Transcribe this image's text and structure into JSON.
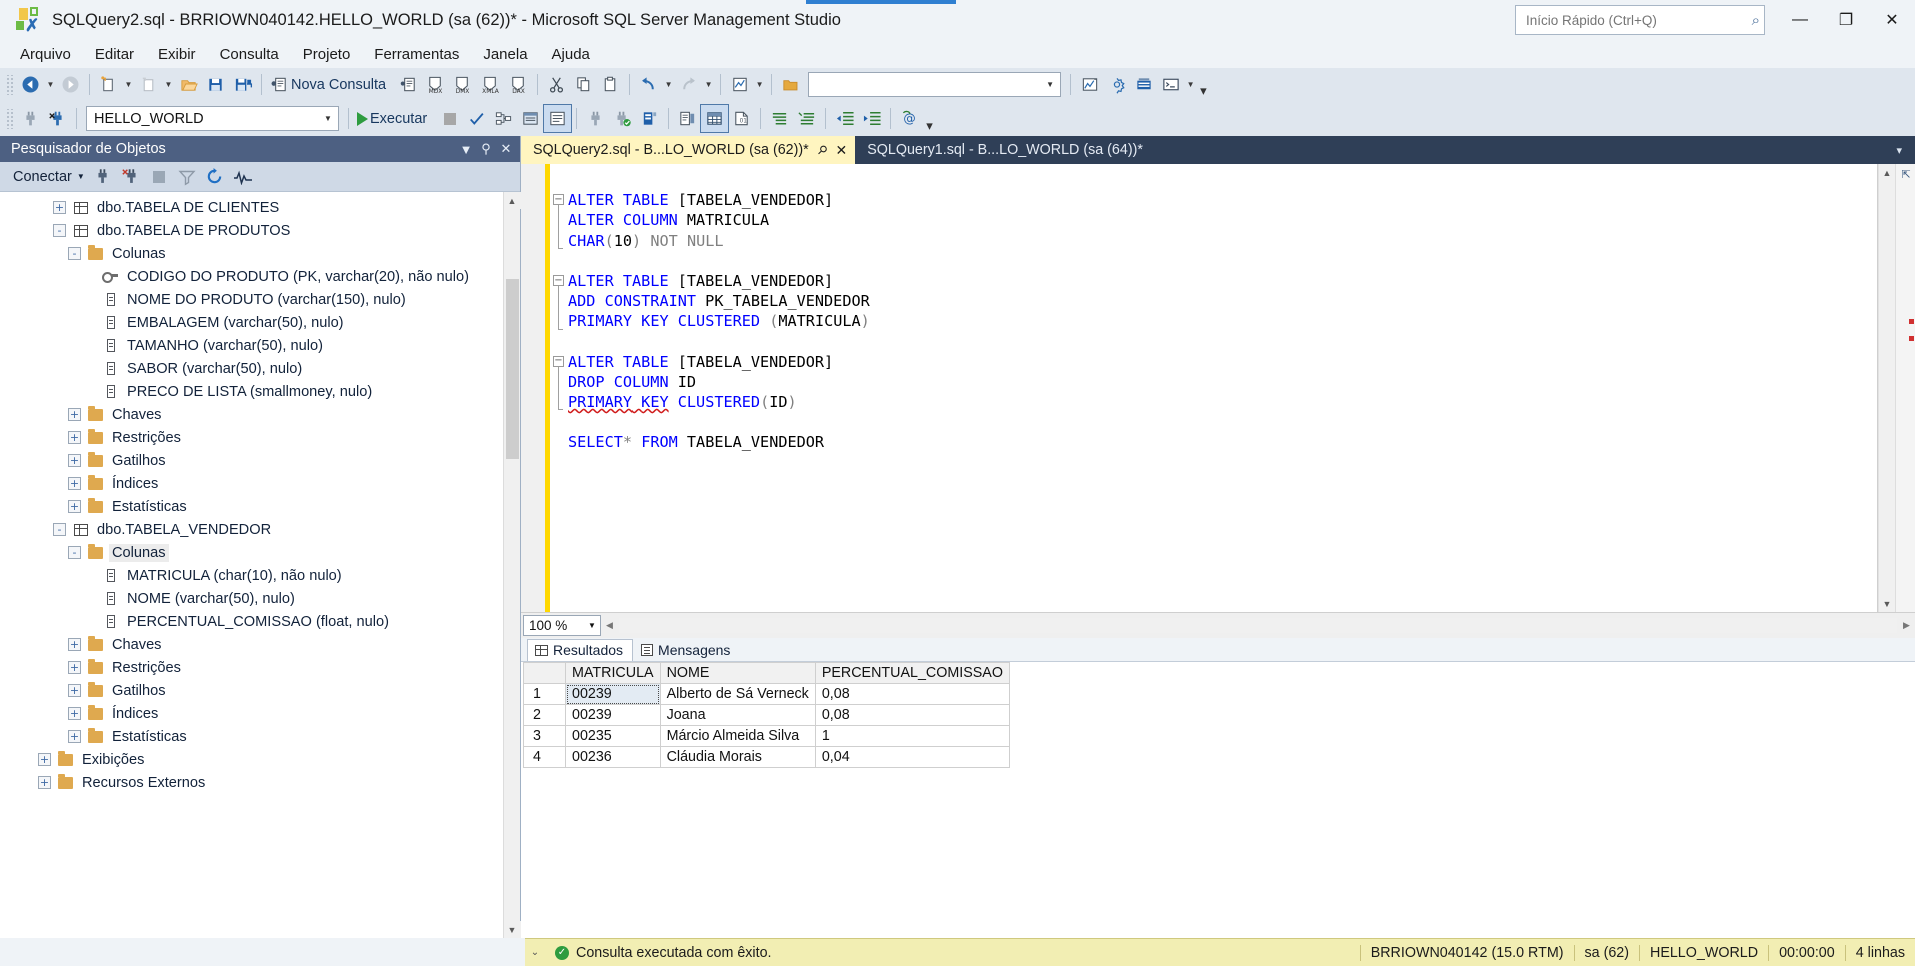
{
  "window": {
    "title": "SQLQuery2.sql - BRRIOWN040142.HELLO_WORLD (sa (62))* - Microsoft SQL Server Management Studio",
    "quick_launch_placeholder": "Início Rápido (Ctrl+Q)",
    "minimize": "—",
    "maximize": "❐",
    "close": "✕",
    "search_icon": "⌕"
  },
  "menu": {
    "items": [
      "Arquivo",
      "Editar",
      "Exibir",
      "Consulta",
      "Projeto",
      "Ferramentas",
      "Janela",
      "Ajuda"
    ]
  },
  "toolbar1": {
    "new_query_label": "Nova Consulta",
    "buttons": [
      "navigate-back",
      "navigate-forward",
      "new-project",
      "new-item",
      "open-file",
      "save",
      "save-all",
      "new-query",
      "new-query-mdx",
      "new-query-dmx",
      "new-query-xmla",
      "new-query-dax",
      "cut",
      "copy",
      "paste",
      "undo",
      "redo",
      "find"
    ],
    "mdx": "MDX",
    "dmx": "DMX",
    "xmla": "XMLA",
    "dax": "DAX",
    "find_value": ""
  },
  "toolbar2": {
    "database_value": "HELLO_WORLD",
    "execute_label": "Executar",
    "buttons": [
      "available-databases",
      "execute",
      "stop",
      "parse",
      "display-estimated-plan",
      "query-options",
      "include-actual-plan",
      "include-client-statistics",
      "results-to-text",
      "results-to-grid",
      "results-to-file",
      "comment",
      "uncomment",
      "decrease-indent",
      "increase-indent",
      "specify-values"
    ]
  },
  "object_explorer": {
    "title": "Pesquisador de Objetos",
    "connect_label": "Conectar",
    "header_buttons": [
      "filter-dropdown",
      "auto-hide-pin",
      "close"
    ],
    "toolbar_buttons": [
      "connect-dropdown",
      "disconnect",
      "disconnect-x",
      "stop",
      "filter",
      "refresh",
      "activity-monitor"
    ],
    "tree": [
      {
        "level": 3,
        "expander": "+",
        "icon": "table",
        "label": "dbo.TABELA DE CLIENTES",
        "selected": false
      },
      {
        "level": 3,
        "expander": "-",
        "icon": "table",
        "label": "dbo.TABELA DE PRODUTOS",
        "selected": false
      },
      {
        "level": 4,
        "expander": "-",
        "icon": "folder",
        "label": "Colunas",
        "selected": false
      },
      {
        "level": 5,
        "expander": "",
        "icon": "key",
        "label": "CODIGO DO PRODUTO (PK, varchar(20), não nulo)",
        "selected": false
      },
      {
        "level": 5,
        "expander": "",
        "icon": "column",
        "label": "NOME DO PRODUTO (varchar(150), nulo)",
        "selected": false
      },
      {
        "level": 5,
        "expander": "",
        "icon": "column",
        "label": "EMBALAGEM (varchar(50), nulo)",
        "selected": false
      },
      {
        "level": 5,
        "expander": "",
        "icon": "column",
        "label": "TAMANHO (varchar(50), nulo)",
        "selected": false
      },
      {
        "level": 5,
        "expander": "",
        "icon": "column",
        "label": "SABOR (varchar(50), nulo)",
        "selected": false
      },
      {
        "level": 5,
        "expander": "",
        "icon": "column",
        "label": "PRECO DE LISTA (smallmoney, nulo)",
        "selected": false
      },
      {
        "level": 4,
        "expander": "+",
        "icon": "folder",
        "label": "Chaves",
        "selected": false
      },
      {
        "level": 4,
        "expander": "+",
        "icon": "folder",
        "label": "Restrições",
        "selected": false
      },
      {
        "level": 4,
        "expander": "+",
        "icon": "folder",
        "label": "Gatilhos",
        "selected": false
      },
      {
        "level": 4,
        "expander": "+",
        "icon": "folder",
        "label": "Índices",
        "selected": false
      },
      {
        "level": 4,
        "expander": "+",
        "icon": "folder",
        "label": "Estatísticas",
        "selected": false
      },
      {
        "level": 3,
        "expander": "-",
        "icon": "table",
        "label": "dbo.TABELA_VENDEDOR",
        "selected": false
      },
      {
        "level": 4,
        "expander": "-",
        "icon": "folder",
        "label": "Colunas",
        "selected": true
      },
      {
        "level": 5,
        "expander": "",
        "icon": "column",
        "label": "MATRICULA (char(10), não nulo)",
        "selected": false
      },
      {
        "level": 5,
        "expander": "",
        "icon": "column",
        "label": "NOME (varchar(50), nulo)",
        "selected": false
      },
      {
        "level": 5,
        "expander": "",
        "icon": "column",
        "label": "PERCENTUAL_COMISSAO (float, nulo)",
        "selected": false
      },
      {
        "level": 4,
        "expander": "+",
        "icon": "folder",
        "label": "Chaves",
        "selected": false
      },
      {
        "level": 4,
        "expander": "+",
        "icon": "folder",
        "label": "Restrições",
        "selected": false
      },
      {
        "level": 4,
        "expander": "+",
        "icon": "folder",
        "label": "Gatilhos",
        "selected": false
      },
      {
        "level": 4,
        "expander": "+",
        "icon": "folder",
        "label": "Índices",
        "selected": false
      },
      {
        "level": 4,
        "expander": "+",
        "icon": "folder",
        "label": "Estatísticas",
        "selected": false
      },
      {
        "level": 2,
        "expander": "+",
        "icon": "folder",
        "label": "Exibições",
        "selected": false
      },
      {
        "level": 2,
        "expander": "+",
        "icon": "folder",
        "label": "Recursos Externos",
        "selected": false
      }
    ]
  },
  "editor": {
    "tabs": [
      {
        "label": "SQLQuery2.sql - B...LO_WORLD (sa (62))*",
        "active": true,
        "pin": "📌",
        "close": "✕"
      },
      {
        "label": "SQLQuery1.sql - B...LO_WORLD (sa (64))*",
        "active": false,
        "pin": "",
        "close": ""
      }
    ],
    "tabstrip_chevron": "▾",
    "zoom_level": "100 %",
    "code_lines": [
      {
        "text": "",
        "fold": "none"
      },
      {
        "text": "ALTER TABLE [TABELA_VENDEDOR]",
        "fold": "start"
      },
      {
        "text": "ALTER COLUMN MATRICULA",
        "fold": "mid"
      },
      {
        "text": "CHAR(10) NOT NULL",
        "fold": "end"
      },
      {
        "text": "",
        "fold": "none"
      },
      {
        "text": "ALTER TABLE [TABELA_VENDEDOR]",
        "fold": "start"
      },
      {
        "text": "ADD CONSTRAINT PK_TABELA_VENDEDOR",
        "fold": "mid"
      },
      {
        "text": "PRIMARY KEY CLUSTERED (MATRICULA)",
        "fold": "end"
      },
      {
        "text": "",
        "fold": "none"
      },
      {
        "text": "ALTER TABLE [TABELA_VENDEDOR]",
        "fold": "start"
      },
      {
        "text": "DROP COLUMN ID",
        "fold": "mid"
      },
      {
        "text": "PRIMARY KEY CLUSTERED(ID)",
        "fold": "end"
      },
      {
        "text": "",
        "fold": "none"
      },
      {
        "text": "SELECT* FROM TABELA_VENDEDOR",
        "fold": "none"
      }
    ]
  },
  "results": {
    "tabs": [
      {
        "label": "Resultados",
        "icon": "grid-icon",
        "active": true
      },
      {
        "label": "Mensagens",
        "icon": "messages-icon",
        "active": false
      }
    ],
    "columns": [
      "MATRICULA",
      "NOME",
      "PERCENTUAL_COMISSAO"
    ],
    "rows": [
      {
        "n": "1",
        "MATRICULA": "00239",
        "NOME": "Alberto de Sá Verneck",
        "PERCENTUAL_COMISSAO": "0,08"
      },
      {
        "n": "2",
        "MATRICULA": "00239",
        "NOME": "Joana",
        "PERCENTUAL_COMISSAO": "0,08"
      },
      {
        "n": "3",
        "MATRICULA": "00235",
        "NOME": "Márcio Almeida Silva",
        "PERCENTUAL_COMISSAO": "1"
      },
      {
        "n": "4",
        "MATRICULA": "00236",
        "NOME": "Cláudia Morais",
        "PERCENTUAL_COMISSAO": "0,04"
      }
    ]
  },
  "statusbar": {
    "message": "Consulta executada com êxito.",
    "server": "BRRIOWN040142 (15.0 RTM)",
    "user": "sa (62)",
    "database": "HELLO_WORLD",
    "elapsed": "00:00:00",
    "rowcount": "4 linhas"
  },
  "colors": {
    "accent": "#2f7fd1",
    "title_bar": "#eff3f7",
    "oe_header": "#4d6082",
    "tab_active": "#fff5c0",
    "tabstrip": "#2f3f57",
    "status_bar": "#f2eeb3",
    "keyword": "#0000ff",
    "change_bar": "#ffd800",
    "success": "#2e9c3f"
  }
}
